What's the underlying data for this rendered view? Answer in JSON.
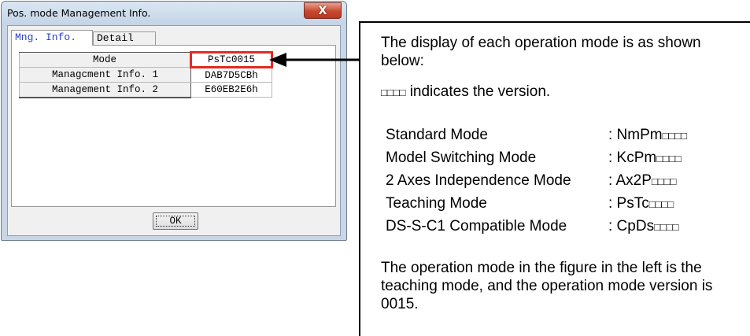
{
  "dialog": {
    "title": "Pos. mode Management Info.",
    "close_label": "X",
    "tabs": [
      {
        "label": "Mng. Info.",
        "active": true
      },
      {
        "label": "Detail",
        "active": false
      }
    ],
    "rows": [
      {
        "label": "Mode",
        "value": "PsTc0015",
        "highlighted": true
      },
      {
        "label": "Managcment Info. 1",
        "value": "DAB7D5CBh"
      },
      {
        "label": "Management Info. 2",
        "value": "E60EB2E6h"
      }
    ],
    "ok_label": "OK"
  },
  "callout": {
    "intro": "The display of each operation mode is as shown below:",
    "version_note": "indicates the version.",
    "boxes": "□□□□",
    "modes": [
      {
        "name": "Standard Mode",
        "code": ": NmPm"
      },
      {
        "name": "Model Switching Mode",
        "code": ": KcPm"
      },
      {
        "name": "2 Axes Independence Mode",
        "code": ": Ax2P"
      },
      {
        "name": "Teaching Mode",
        "code": ": PsTc"
      },
      {
        "name": "DS-S-C1 Compatible Mode",
        "code": ": CpDs"
      }
    ],
    "summary": "The operation mode in the figure in the left is the teaching mode, and the operation mode version is 0015."
  },
  "colors": {
    "highlight": "#e42a22",
    "active_tab_text": "#2a40c8",
    "close_button": "#c7482e"
  }
}
